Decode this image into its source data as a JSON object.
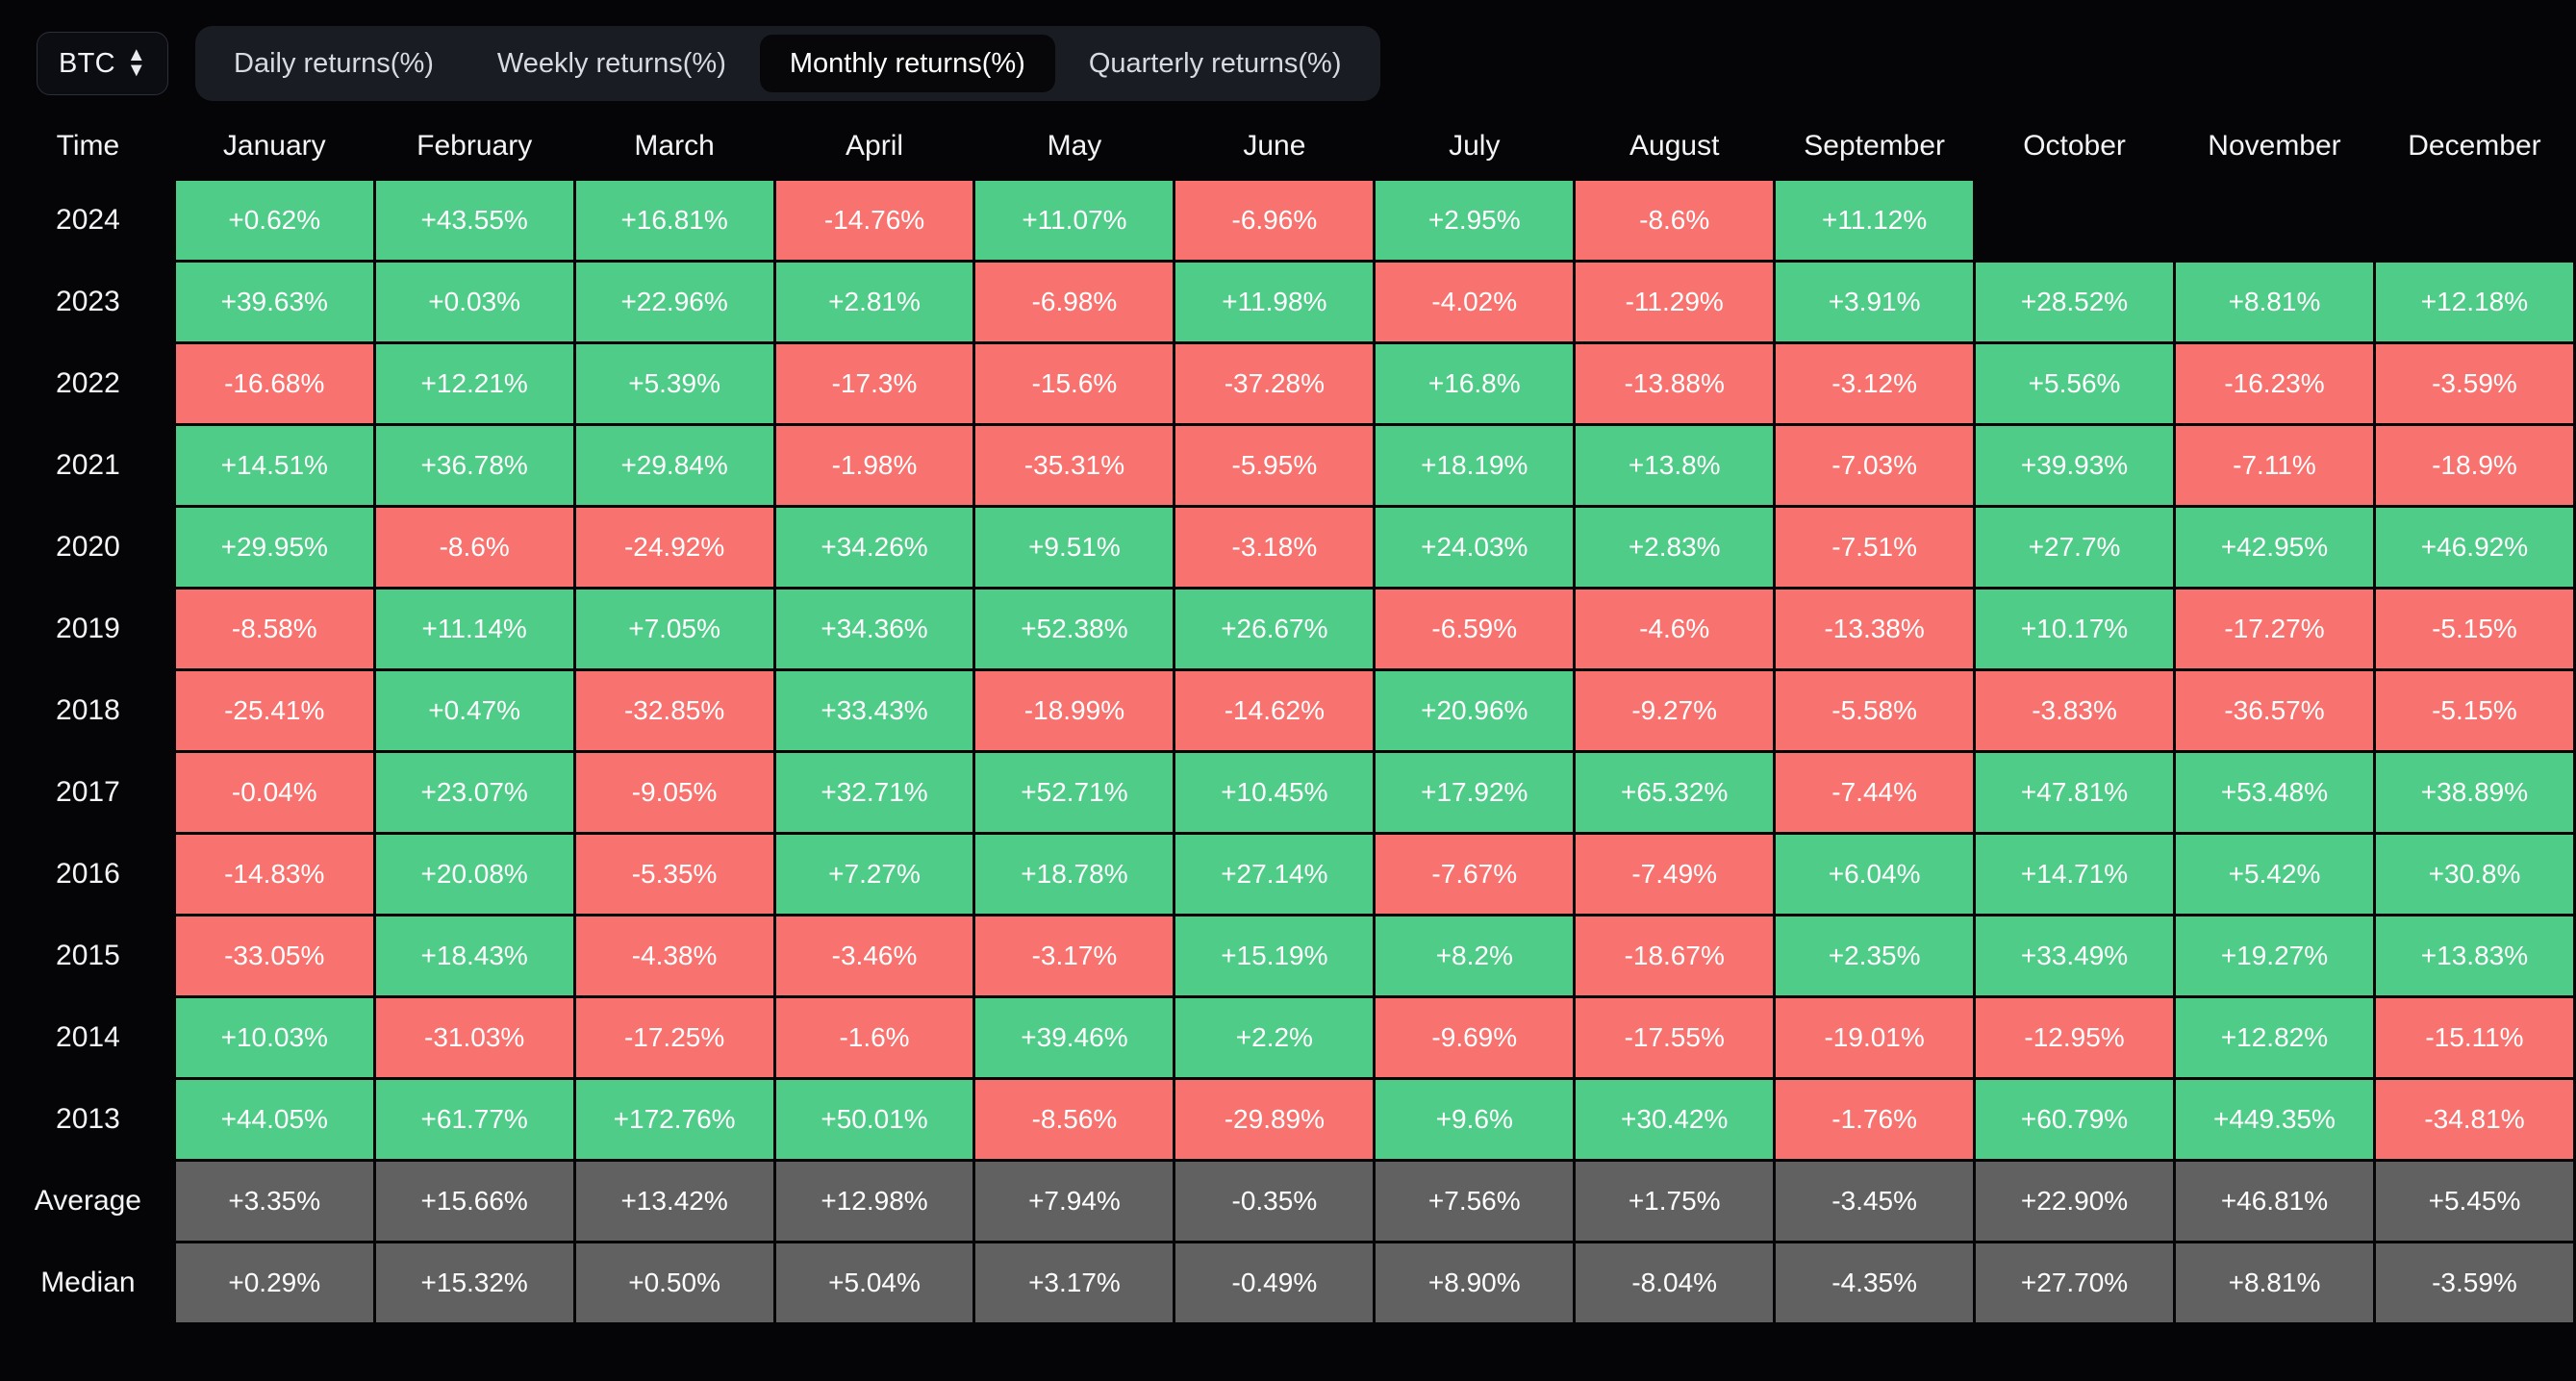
{
  "toolbar": {
    "symbol": "BTC",
    "symbol_icon": "updown-stepper-icon",
    "tabs": [
      {
        "label": "Daily returns(%)",
        "active": false
      },
      {
        "label": "Weekly returns(%)",
        "active": false
      },
      {
        "label": "Monthly returns(%)",
        "active": true
      },
      {
        "label": "Quarterly returns(%)",
        "active": false
      }
    ]
  },
  "colors": {
    "positive": "#4fcc87",
    "negative": "#f8736f",
    "stat": "#616161",
    "background": "#050507",
    "tab_bar": "#191c23",
    "tab_active": "#070709"
  },
  "chart_data": {
    "type": "heatmap",
    "title": "Monthly returns(%)",
    "symbol": "BTC",
    "xlabel": "",
    "ylabel": "Time",
    "row_header": "Time",
    "categories": [
      "January",
      "February",
      "March",
      "April",
      "May",
      "June",
      "July",
      "August",
      "September",
      "October",
      "November",
      "December"
    ],
    "rows": [
      {
        "label": "2024",
        "kind": "year",
        "values": [
          "+0.62%",
          "+43.55%",
          "+16.81%",
          "-14.76%",
          "+11.07%",
          "-6.96%",
          "+2.95%",
          "-8.6%",
          "+11.12%",
          "",
          "",
          ""
        ]
      },
      {
        "label": "2023",
        "kind": "year",
        "values": [
          "+39.63%",
          "+0.03%",
          "+22.96%",
          "+2.81%",
          "-6.98%",
          "+11.98%",
          "-4.02%",
          "-11.29%",
          "+3.91%",
          "+28.52%",
          "+8.81%",
          "+12.18%"
        ]
      },
      {
        "label": "2022",
        "kind": "year",
        "values": [
          "-16.68%",
          "+12.21%",
          "+5.39%",
          "-17.3%",
          "-15.6%",
          "-37.28%",
          "+16.8%",
          "-13.88%",
          "-3.12%",
          "+5.56%",
          "-16.23%",
          "-3.59%"
        ]
      },
      {
        "label": "2021",
        "kind": "year",
        "values": [
          "+14.51%",
          "+36.78%",
          "+29.84%",
          "-1.98%",
          "-35.31%",
          "-5.95%",
          "+18.19%",
          "+13.8%",
          "-7.03%",
          "+39.93%",
          "-7.11%",
          "-18.9%"
        ]
      },
      {
        "label": "2020",
        "kind": "year",
        "values": [
          "+29.95%",
          "-8.6%",
          "-24.92%",
          "+34.26%",
          "+9.51%",
          "-3.18%",
          "+24.03%",
          "+2.83%",
          "-7.51%",
          "+27.7%",
          "+42.95%",
          "+46.92%"
        ]
      },
      {
        "label": "2019",
        "kind": "year",
        "values": [
          "-8.58%",
          "+11.14%",
          "+7.05%",
          "+34.36%",
          "+52.38%",
          "+26.67%",
          "-6.59%",
          "-4.6%",
          "-13.38%",
          "+10.17%",
          "-17.27%",
          "-5.15%"
        ]
      },
      {
        "label": "2018",
        "kind": "year",
        "values": [
          "-25.41%",
          "+0.47%",
          "-32.85%",
          "+33.43%",
          "-18.99%",
          "-14.62%",
          "+20.96%",
          "-9.27%",
          "-5.58%",
          "-3.83%",
          "-36.57%",
          "-5.15%"
        ]
      },
      {
        "label": "2017",
        "kind": "year",
        "values": [
          "-0.04%",
          "+23.07%",
          "-9.05%",
          "+32.71%",
          "+52.71%",
          "+10.45%",
          "+17.92%",
          "+65.32%",
          "-7.44%",
          "+47.81%",
          "+53.48%",
          "+38.89%"
        ]
      },
      {
        "label": "2016",
        "kind": "year",
        "values": [
          "-14.83%",
          "+20.08%",
          "-5.35%",
          "+7.27%",
          "+18.78%",
          "+27.14%",
          "-7.67%",
          "-7.49%",
          "+6.04%",
          "+14.71%",
          "+5.42%",
          "+30.8%"
        ]
      },
      {
        "label": "2015",
        "kind": "year",
        "values": [
          "-33.05%",
          "+18.43%",
          "-4.38%",
          "-3.46%",
          "-3.17%",
          "+15.19%",
          "+8.2%",
          "-18.67%",
          "+2.35%",
          "+33.49%",
          "+19.27%",
          "+13.83%"
        ]
      },
      {
        "label": "2014",
        "kind": "year",
        "values": [
          "+10.03%",
          "-31.03%",
          "-17.25%",
          "-1.6%",
          "+39.46%",
          "+2.2%",
          "-9.69%",
          "-17.55%",
          "-19.01%",
          "-12.95%",
          "+12.82%",
          "-15.11%"
        ]
      },
      {
        "label": "2013",
        "kind": "year",
        "values": [
          "+44.05%",
          "+61.77%",
          "+172.76%",
          "+50.01%",
          "-8.56%",
          "-29.89%",
          "+9.6%",
          "+30.42%",
          "-1.76%",
          "+60.79%",
          "+449.35%",
          "-34.81%"
        ]
      },
      {
        "label": "Average",
        "kind": "stat",
        "values": [
          "+3.35%",
          "+15.66%",
          "+13.42%",
          "+12.98%",
          "+7.94%",
          "-0.35%",
          "+7.56%",
          "+1.75%",
          "-3.45%",
          "+22.90%",
          "+46.81%",
          "+5.45%"
        ]
      },
      {
        "label": "Median",
        "kind": "stat",
        "values": [
          "+0.29%",
          "+15.32%",
          "+0.50%",
          "+5.04%",
          "+3.17%",
          "-0.49%",
          "+8.90%",
          "-8.04%",
          "-4.35%",
          "+27.70%",
          "+8.81%",
          "-3.59%"
        ]
      }
    ]
  }
}
